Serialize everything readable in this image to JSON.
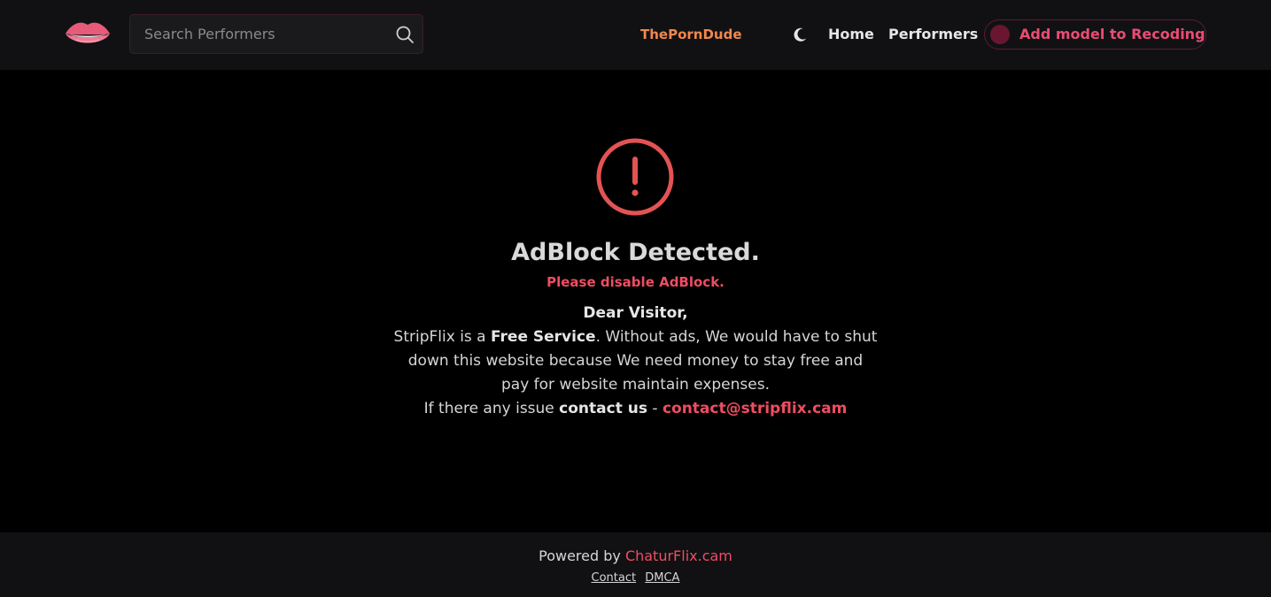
{
  "header": {
    "logo_icon": "lips-icon",
    "search": {
      "placeholder": "Search Performers",
      "value": "",
      "icon": "search-icon"
    },
    "links": {
      "porndude": "ThePornDude",
      "home": "Home",
      "performers": "Performers"
    },
    "theme_icon": "moon-icon",
    "add_model_label": "Add model to Recoding"
  },
  "notice": {
    "icon": "alert-circle-icon",
    "title": "AdBlock Detected.",
    "subtitle": "Please disable AdBlock.",
    "greeting": "Dear Visitor,",
    "line1_pre": "StripFlix is a ",
    "line1_bold": "Free Service",
    "line1_post": ". Without ads, We would have to shut",
    "line2": "down this website because We need money to stay free and",
    "line3": "pay for website maintain expenses.",
    "line4_pre": "If there any issue ",
    "line4_bold": "contact us",
    "line4_sep": " - ",
    "email": "contact@stripflix.cam"
  },
  "footer": {
    "powered_prefix": "Powered by ",
    "powered_link": "ChaturFlix.cam",
    "contact": "Contact",
    "dmca": "DMCA"
  },
  "colors": {
    "accent": "#ee4d63",
    "porndude": "#f0884d",
    "background": "#000000",
    "bar": "#111113"
  }
}
